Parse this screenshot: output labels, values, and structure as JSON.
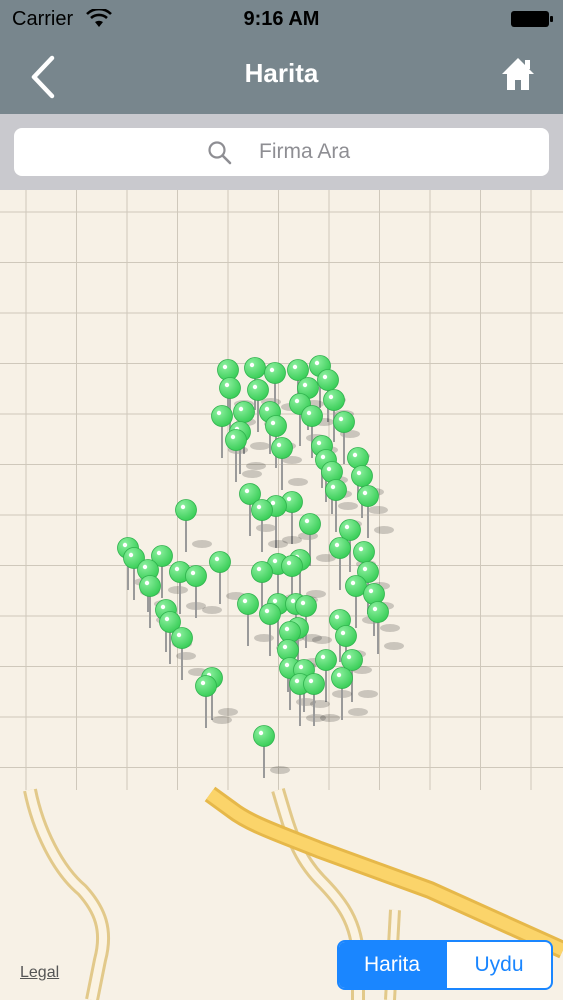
{
  "status_bar": {
    "carrier": "Carrier",
    "time": "9:16 AM"
  },
  "nav": {
    "title": "Harita",
    "back_icon": "chevron-left-icon",
    "home_icon": "home-icon"
  },
  "search": {
    "placeholder": "Firma Ara",
    "icon": "search-icon"
  },
  "map": {
    "legal_label": "Legal",
    "pin_color": "#4cd964",
    "accent": "#1a86ff"
  },
  "segmented": {
    "options": [
      "Harita",
      "Uydu"
    ],
    "selected": "Harita"
  }
}
